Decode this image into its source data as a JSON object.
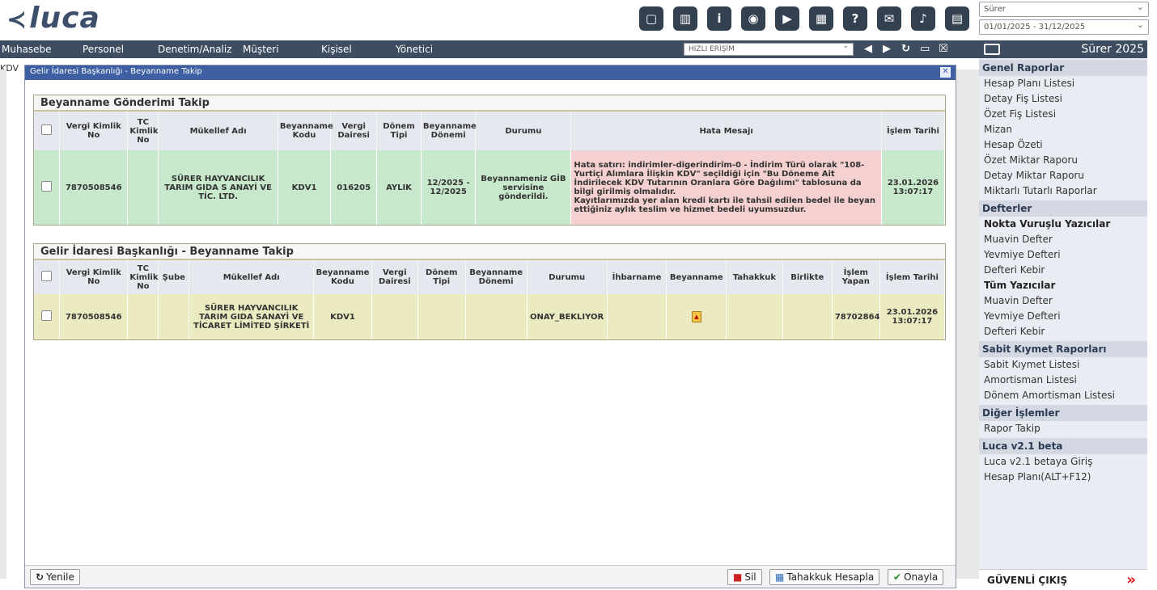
{
  "app": {
    "logo": "luca"
  },
  "header": {
    "icons": [
      "note-icon",
      "book-icon",
      "info-icon",
      "globe-icon",
      "youtube-icon",
      "calculator-icon",
      "help-icon",
      "announcement-icon",
      "bell-icon",
      "notebook-icon"
    ],
    "company_select": "Sürer",
    "period_select": "01/01/2025 - 31/12/2025"
  },
  "menu": {
    "items": [
      "Muhasebe",
      "Personel",
      "Denetim/Analiz",
      "Müşteri",
      "Kişisel",
      "Yönetici"
    ],
    "quick_access_placeholder": "HIZLI ERİŞİM",
    "year_label": "Sürer 2025"
  },
  "background": {
    "kdv_label": "KDV"
  },
  "modal": {
    "title": "Gelir İdaresi Başkanlığı - Beyanname Takip",
    "panel1": {
      "title": "Beyanname Gönderimi Takip",
      "headers": [
        "Vergi Kimlik No",
        "TC Kimlik No",
        "Mükellef Adı",
        "Beyanname Kodu",
        "Vergi Dairesi",
        "Dönem Tipi",
        "Beyanname Dönemi",
        "Durumu",
        "Hata Mesajı",
        "İşlem Tarihi"
      ],
      "row": {
        "vkn": "7870508546",
        "tckn": "",
        "mukellef": "SÜRER HAYVANCILIK TARIM GIDA S ANAYİ VE TİC. LTD.",
        "kod": "KDV1",
        "daire": "016205",
        "donem_tipi": "AYLIK",
        "donem": "12/2025 - 12/2025",
        "durum": "Beyannameniz GİB servisine gönderildi.",
        "hata": "Hata satırı: indirimler-digerindirim-0 - İndirim Türü olarak \"108-Yurtiçi Alımlara İlişkin KDV\" seçildiği için \"Bu Döneme Ait İndirilecek KDV Tutarının Oranlara Göre Dağılımı\" tablosuna da bilgi girilmiş olmalıdır.",
        "hata2": "Kayıtlarımızda yer alan kredi kartı ile tahsil edilen bedel ile beyan ettiğiniz aylık teslim ve hizmet bedeli uyumsuzdur.",
        "tarih": "23.01.2026 13:07:17"
      }
    },
    "panel2": {
      "title": "Gelir İdaresi Başkanlığı - Beyanname Takip",
      "headers": [
        "Vergi Kimlik No",
        "TC Kimlik No",
        "Şube",
        "Mükellef Adı",
        "Beyanname Kodu",
        "Vergi Dairesi",
        "Dönem Tipi",
        "Beyanname Dönemi",
        "Durumu",
        "İhbarname",
        "Beyanname",
        "Tahakkuk",
        "Birlikte",
        "İşlem Yapan",
        "İşlem Tarihi"
      ],
      "row": {
        "vkn": "7870508546",
        "mukellef": "SÜRER HAYVANCILIK TARIM GIDA SANAYİ VE TİCARET LİMİTED ŞİRKETİ",
        "kod": "KDV1",
        "durum": "ONAY_BEKLIYOR",
        "yapan": "78702864",
        "tarih": "23.01.2026 13:07:17"
      }
    },
    "buttons": {
      "refresh": "Yenile",
      "delete": "Sil",
      "tahakkuk": "Tahakkuk Hesapla",
      "approve": "Onayla"
    }
  },
  "right_panel": {
    "sections": [
      {
        "title": "Genel Raporlar",
        "items": [
          "Hesap Planı Listesi",
          "Detay Fiş Listesi",
          "Özet Fiş Listesi",
          "Mizan",
          "Hesap Özeti",
          "Özet Miktar Raporu",
          "Detay Miktar Raporu",
          "Miktarlı Tutarlı Raporlar"
        ]
      },
      {
        "title": "Defterler",
        "items": [
          "Nokta Vuruşlu Yazıcılar",
          "Muavin Defter",
          "Yevmiye Defteri",
          "Defteri Kebir",
          "Tüm Yazıcılar",
          "Muavin Defter",
          "Yevmiye Defteri",
          "Defteri Kebir"
        ]
      },
      {
        "title": "Sabit Kıymet Raporları",
        "items": [
          "Sabit Kıymet Listesi",
          "Amortisman Listesi",
          "Dönem Amortisman Listesi"
        ]
      },
      {
        "title": "Diğer İşlemler",
        "items": [
          "Rapor Takip"
        ]
      },
      {
        "title": "Luca v2.1 beta",
        "items": [
          "Luca v2.1 betaya Giriş",
          "Hesap Planı(ALT+F12)"
        ]
      }
    ],
    "logout": "GÜVENLİ ÇIKIŞ"
  }
}
